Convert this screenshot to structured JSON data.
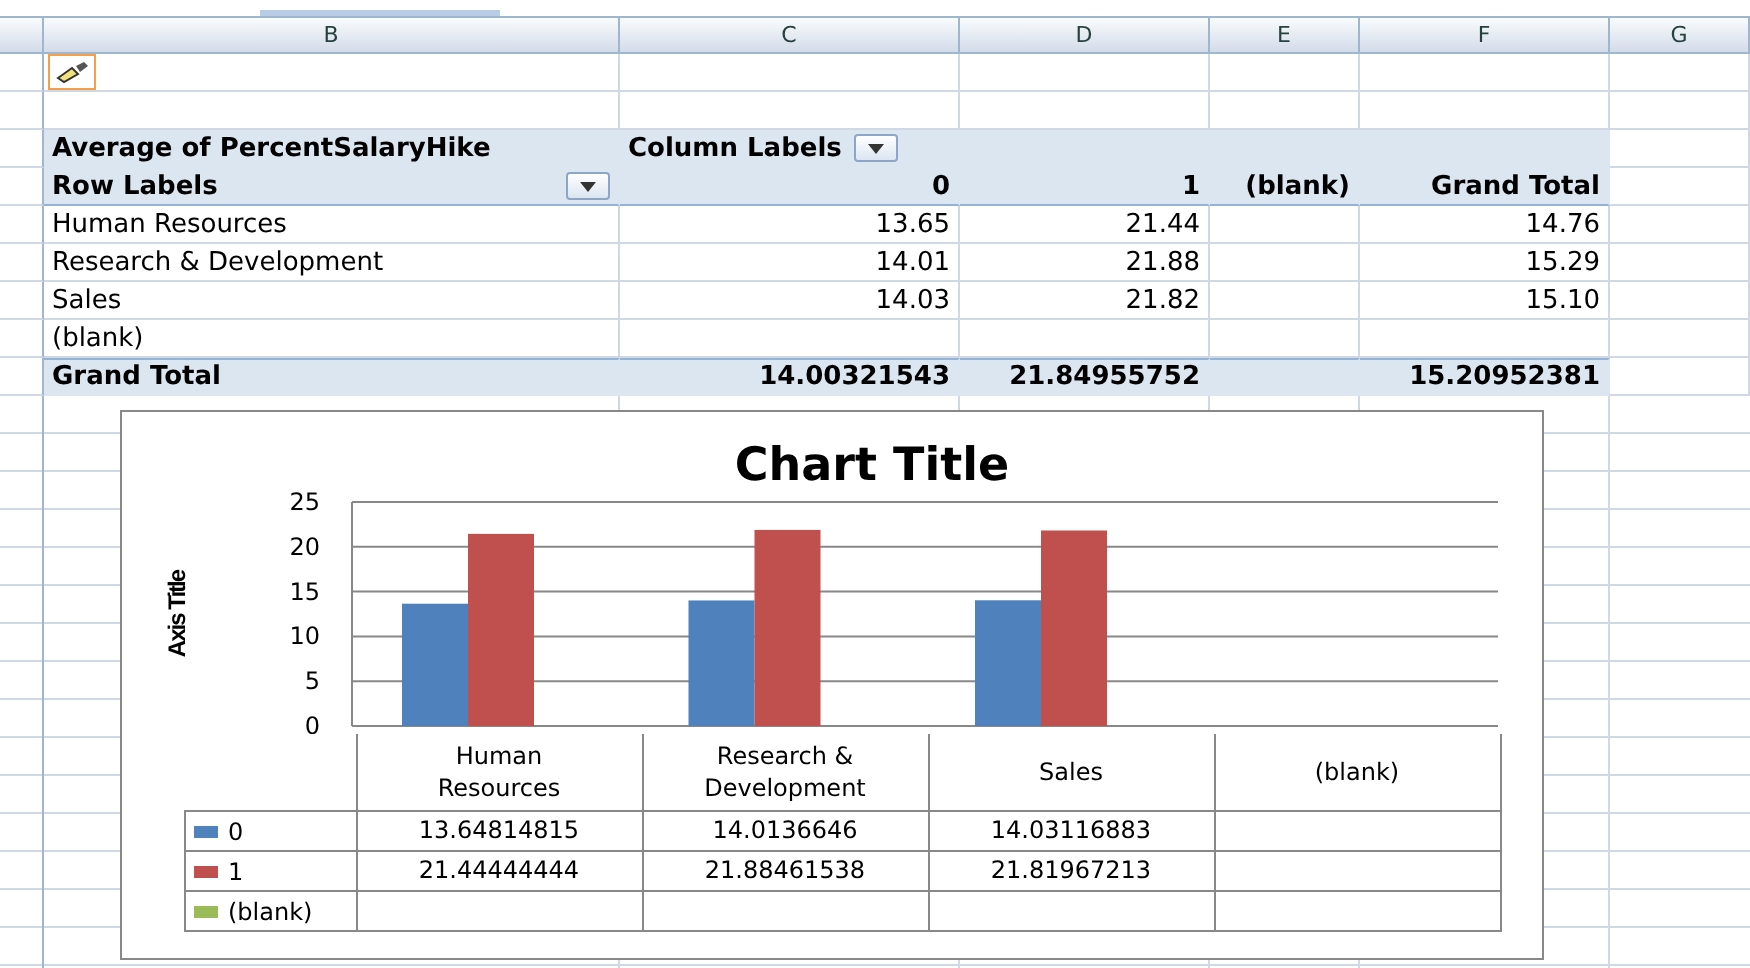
{
  "column_headers": [
    "B",
    "C",
    "D",
    "E",
    "F",
    "G"
  ],
  "pivot": {
    "value_field": "Average of PercentSalaryHike",
    "column_labels": "Column Labels",
    "row_labels": "Row Labels",
    "columns": [
      "0",
      "1",
      "(blank)",
      "Grand Total"
    ],
    "rows": [
      {
        "label": "Human Resources",
        "col_0": "13.65",
        "col_1": "21.44",
        "grand_total": "14.76"
      },
      {
        "label": "Research & Development",
        "col_0": "14.01",
        "col_1": "21.88",
        "grand_total": "15.29"
      },
      {
        "label": "Sales",
        "col_0": "14.03",
        "col_1": "21.82",
        "grand_total": "15.10"
      },
      {
        "label": "(blank)"
      }
    ],
    "grand_total": {
      "label": "Grand Total",
      "col_0": "14.00321543",
      "col_1": "21.84955752",
      "grand_total": "15.20952381"
    }
  },
  "chart": {
    "chart_data": {
      "type": "bar",
      "title": "Chart Title",
      "ylabel": "Axis Title",
      "categories": [
        "Human Resources",
        "Research & Development",
        "Sales",
        "(blank)"
      ],
      "series": [
        {
          "name": "0",
          "color": "#4f81bd",
          "values": [
            13.64814815,
            14.0136646,
            14.03116883,
            null
          ]
        },
        {
          "name": "1",
          "color": "#c0504d",
          "values": [
            21.44444444,
            21.88461538,
            21.81967213,
            null
          ]
        },
        {
          "name": "(blank)",
          "color": "#9bbb59",
          "values": [
            null,
            null,
            null,
            null
          ]
        }
      ],
      "ylim": [
        0,
        25
      ],
      "yticks": [
        0,
        5,
        10,
        15,
        20,
        25
      ],
      "grid": true,
      "legend": "bottom left"
    },
    "data_table": [
      {
        "cells": [
          "13.64814815",
          "14.0136646",
          "14.03116883"
        ]
      },
      {
        "cells": [
          "21.44444444",
          "21.88461538",
          "21.81967213"
        ]
      }
    ]
  }
}
